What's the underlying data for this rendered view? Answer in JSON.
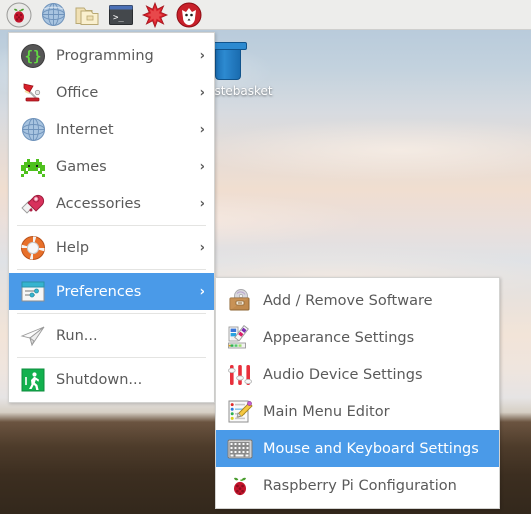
{
  "taskbar": {
    "buttons": [
      {
        "name": "raspberry-pi-menu-button",
        "icon": "raspberry-icon",
        "label": "Menu"
      },
      {
        "name": "web-browser-button",
        "icon": "globe-icon",
        "label": "Web Browser"
      },
      {
        "name": "file-manager-button",
        "icon": "folder-icon",
        "label": "File Manager"
      },
      {
        "name": "terminal-button",
        "icon": "terminal-icon",
        "label": "Terminal"
      },
      {
        "name": "mathematica-button",
        "icon": "mathematica-star-icon",
        "label": "Mathematica"
      },
      {
        "name": "wolfram-button",
        "icon": "wolfram-fox-icon",
        "label": "Wolfram"
      }
    ]
  },
  "desktop": {
    "icons": [
      {
        "name": "wastebasket-icon",
        "label": "Wastebasket"
      }
    ]
  },
  "main_menu": {
    "items": [
      {
        "label": "Programming",
        "icon": "braces-icon",
        "has_submenu": true,
        "selected": false
      },
      {
        "label": "Office",
        "icon": "desk-lamp-icon",
        "has_submenu": true,
        "selected": false
      },
      {
        "label": "Internet",
        "icon": "globe-icon",
        "has_submenu": true,
        "selected": false
      },
      {
        "label": "Games",
        "icon": "space-invader-icon",
        "has_submenu": true,
        "selected": false
      },
      {
        "label": "Accessories",
        "icon": "pocket-knife-icon",
        "has_submenu": true,
        "selected": false
      },
      {
        "label": "Help",
        "icon": "life-ring-icon",
        "has_submenu": true,
        "selected": false
      },
      {
        "label": "Preferences",
        "icon": "sliders-window-icon",
        "has_submenu": true,
        "selected": true
      },
      {
        "label": "Run...",
        "icon": "paper-plane-icon",
        "has_submenu": false,
        "selected": false
      },
      {
        "label": "Shutdown...",
        "icon": "exit-runner-icon",
        "has_submenu": false,
        "selected": false
      }
    ],
    "separators_after": [
      4,
      6,
      7
    ],
    "arrow_glyph": "›"
  },
  "preferences_submenu": {
    "items": [
      {
        "label": "Add / Remove Software",
        "icon": "software-briefcase-icon",
        "selected": false
      },
      {
        "label": "Appearance Settings",
        "icon": "color-palette-icon",
        "selected": false
      },
      {
        "label": "Audio Device Settings",
        "icon": "audio-sliders-icon",
        "selected": false
      },
      {
        "label": "Main Menu Editor",
        "icon": "menu-editor-icon",
        "selected": false
      },
      {
        "label": "Mouse and Keyboard Settings",
        "icon": "keyboard-icon",
        "selected": true
      },
      {
        "label": "Raspberry Pi Configuration",
        "icon": "raspberry-icon",
        "selected": false
      }
    ]
  },
  "colors": {
    "highlight": "#4a9ae8",
    "menu_background": "#ffffff",
    "menu_text": "#5a5a5a",
    "taskbar_background": "#ededeb",
    "selected_text": "#ffffff"
  }
}
